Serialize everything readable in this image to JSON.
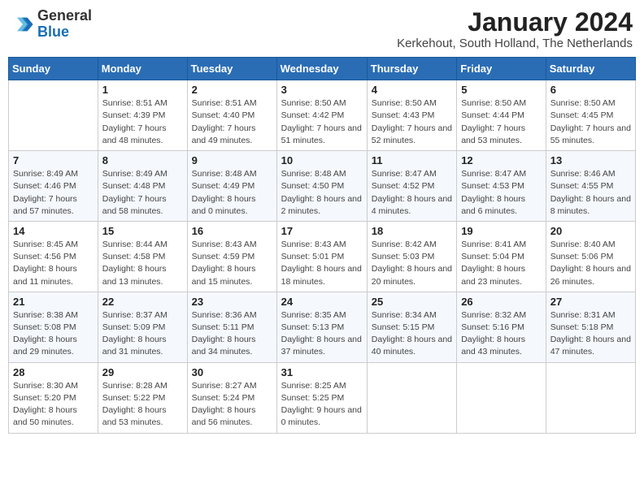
{
  "logo": {
    "general": "General",
    "blue": "Blue"
  },
  "header": {
    "month": "January 2024",
    "location": "Kerkehout, South Holland, The Netherlands"
  },
  "weekdays": [
    "Sunday",
    "Monday",
    "Tuesday",
    "Wednesday",
    "Thursday",
    "Friday",
    "Saturday"
  ],
  "weeks": [
    [
      {
        "day": "",
        "sunrise": "",
        "sunset": "",
        "daylight": ""
      },
      {
        "day": "1",
        "sunrise": "Sunrise: 8:51 AM",
        "sunset": "Sunset: 4:39 PM",
        "daylight": "Daylight: 7 hours and 48 minutes."
      },
      {
        "day": "2",
        "sunrise": "Sunrise: 8:51 AM",
        "sunset": "Sunset: 4:40 PM",
        "daylight": "Daylight: 7 hours and 49 minutes."
      },
      {
        "day": "3",
        "sunrise": "Sunrise: 8:50 AM",
        "sunset": "Sunset: 4:42 PM",
        "daylight": "Daylight: 7 hours and 51 minutes."
      },
      {
        "day": "4",
        "sunrise": "Sunrise: 8:50 AM",
        "sunset": "Sunset: 4:43 PM",
        "daylight": "Daylight: 7 hours and 52 minutes."
      },
      {
        "day": "5",
        "sunrise": "Sunrise: 8:50 AM",
        "sunset": "Sunset: 4:44 PM",
        "daylight": "Daylight: 7 hours and 53 minutes."
      },
      {
        "day": "6",
        "sunrise": "Sunrise: 8:50 AM",
        "sunset": "Sunset: 4:45 PM",
        "daylight": "Daylight: 7 hours and 55 minutes."
      }
    ],
    [
      {
        "day": "7",
        "sunrise": "Sunrise: 8:49 AM",
        "sunset": "Sunset: 4:46 PM",
        "daylight": "Daylight: 7 hours and 57 minutes."
      },
      {
        "day": "8",
        "sunrise": "Sunrise: 8:49 AM",
        "sunset": "Sunset: 4:48 PM",
        "daylight": "Daylight: 7 hours and 58 minutes."
      },
      {
        "day": "9",
        "sunrise": "Sunrise: 8:48 AM",
        "sunset": "Sunset: 4:49 PM",
        "daylight": "Daylight: 8 hours and 0 minutes."
      },
      {
        "day": "10",
        "sunrise": "Sunrise: 8:48 AM",
        "sunset": "Sunset: 4:50 PM",
        "daylight": "Daylight: 8 hours and 2 minutes."
      },
      {
        "day": "11",
        "sunrise": "Sunrise: 8:47 AM",
        "sunset": "Sunset: 4:52 PM",
        "daylight": "Daylight: 8 hours and 4 minutes."
      },
      {
        "day": "12",
        "sunrise": "Sunrise: 8:47 AM",
        "sunset": "Sunset: 4:53 PM",
        "daylight": "Daylight: 8 hours and 6 minutes."
      },
      {
        "day": "13",
        "sunrise": "Sunrise: 8:46 AM",
        "sunset": "Sunset: 4:55 PM",
        "daylight": "Daylight: 8 hours and 8 minutes."
      }
    ],
    [
      {
        "day": "14",
        "sunrise": "Sunrise: 8:45 AM",
        "sunset": "Sunset: 4:56 PM",
        "daylight": "Daylight: 8 hours and 11 minutes."
      },
      {
        "day": "15",
        "sunrise": "Sunrise: 8:44 AM",
        "sunset": "Sunset: 4:58 PM",
        "daylight": "Daylight: 8 hours and 13 minutes."
      },
      {
        "day": "16",
        "sunrise": "Sunrise: 8:43 AM",
        "sunset": "Sunset: 4:59 PM",
        "daylight": "Daylight: 8 hours and 15 minutes."
      },
      {
        "day": "17",
        "sunrise": "Sunrise: 8:43 AM",
        "sunset": "Sunset: 5:01 PM",
        "daylight": "Daylight: 8 hours and 18 minutes."
      },
      {
        "day": "18",
        "sunrise": "Sunrise: 8:42 AM",
        "sunset": "Sunset: 5:03 PM",
        "daylight": "Daylight: 8 hours and 20 minutes."
      },
      {
        "day": "19",
        "sunrise": "Sunrise: 8:41 AM",
        "sunset": "Sunset: 5:04 PM",
        "daylight": "Daylight: 8 hours and 23 minutes."
      },
      {
        "day": "20",
        "sunrise": "Sunrise: 8:40 AM",
        "sunset": "Sunset: 5:06 PM",
        "daylight": "Daylight: 8 hours and 26 minutes."
      }
    ],
    [
      {
        "day": "21",
        "sunrise": "Sunrise: 8:38 AM",
        "sunset": "Sunset: 5:08 PM",
        "daylight": "Daylight: 8 hours and 29 minutes."
      },
      {
        "day": "22",
        "sunrise": "Sunrise: 8:37 AM",
        "sunset": "Sunset: 5:09 PM",
        "daylight": "Daylight: 8 hours and 31 minutes."
      },
      {
        "day": "23",
        "sunrise": "Sunrise: 8:36 AM",
        "sunset": "Sunset: 5:11 PM",
        "daylight": "Daylight: 8 hours and 34 minutes."
      },
      {
        "day": "24",
        "sunrise": "Sunrise: 8:35 AM",
        "sunset": "Sunset: 5:13 PM",
        "daylight": "Daylight: 8 hours and 37 minutes."
      },
      {
        "day": "25",
        "sunrise": "Sunrise: 8:34 AM",
        "sunset": "Sunset: 5:15 PM",
        "daylight": "Daylight: 8 hours and 40 minutes."
      },
      {
        "day": "26",
        "sunrise": "Sunrise: 8:32 AM",
        "sunset": "Sunset: 5:16 PM",
        "daylight": "Daylight: 8 hours and 43 minutes."
      },
      {
        "day": "27",
        "sunrise": "Sunrise: 8:31 AM",
        "sunset": "Sunset: 5:18 PM",
        "daylight": "Daylight: 8 hours and 47 minutes."
      }
    ],
    [
      {
        "day": "28",
        "sunrise": "Sunrise: 8:30 AM",
        "sunset": "Sunset: 5:20 PM",
        "daylight": "Daylight: 8 hours and 50 minutes."
      },
      {
        "day": "29",
        "sunrise": "Sunrise: 8:28 AM",
        "sunset": "Sunset: 5:22 PM",
        "daylight": "Daylight: 8 hours and 53 minutes."
      },
      {
        "day": "30",
        "sunrise": "Sunrise: 8:27 AM",
        "sunset": "Sunset: 5:24 PM",
        "daylight": "Daylight: 8 hours and 56 minutes."
      },
      {
        "day": "31",
        "sunrise": "Sunrise: 8:25 AM",
        "sunset": "Sunset: 5:25 PM",
        "daylight": "Daylight: 9 hours and 0 minutes."
      },
      {
        "day": "",
        "sunrise": "",
        "sunset": "",
        "daylight": ""
      },
      {
        "day": "",
        "sunrise": "",
        "sunset": "",
        "daylight": ""
      },
      {
        "day": "",
        "sunrise": "",
        "sunset": "",
        "daylight": ""
      }
    ]
  ]
}
